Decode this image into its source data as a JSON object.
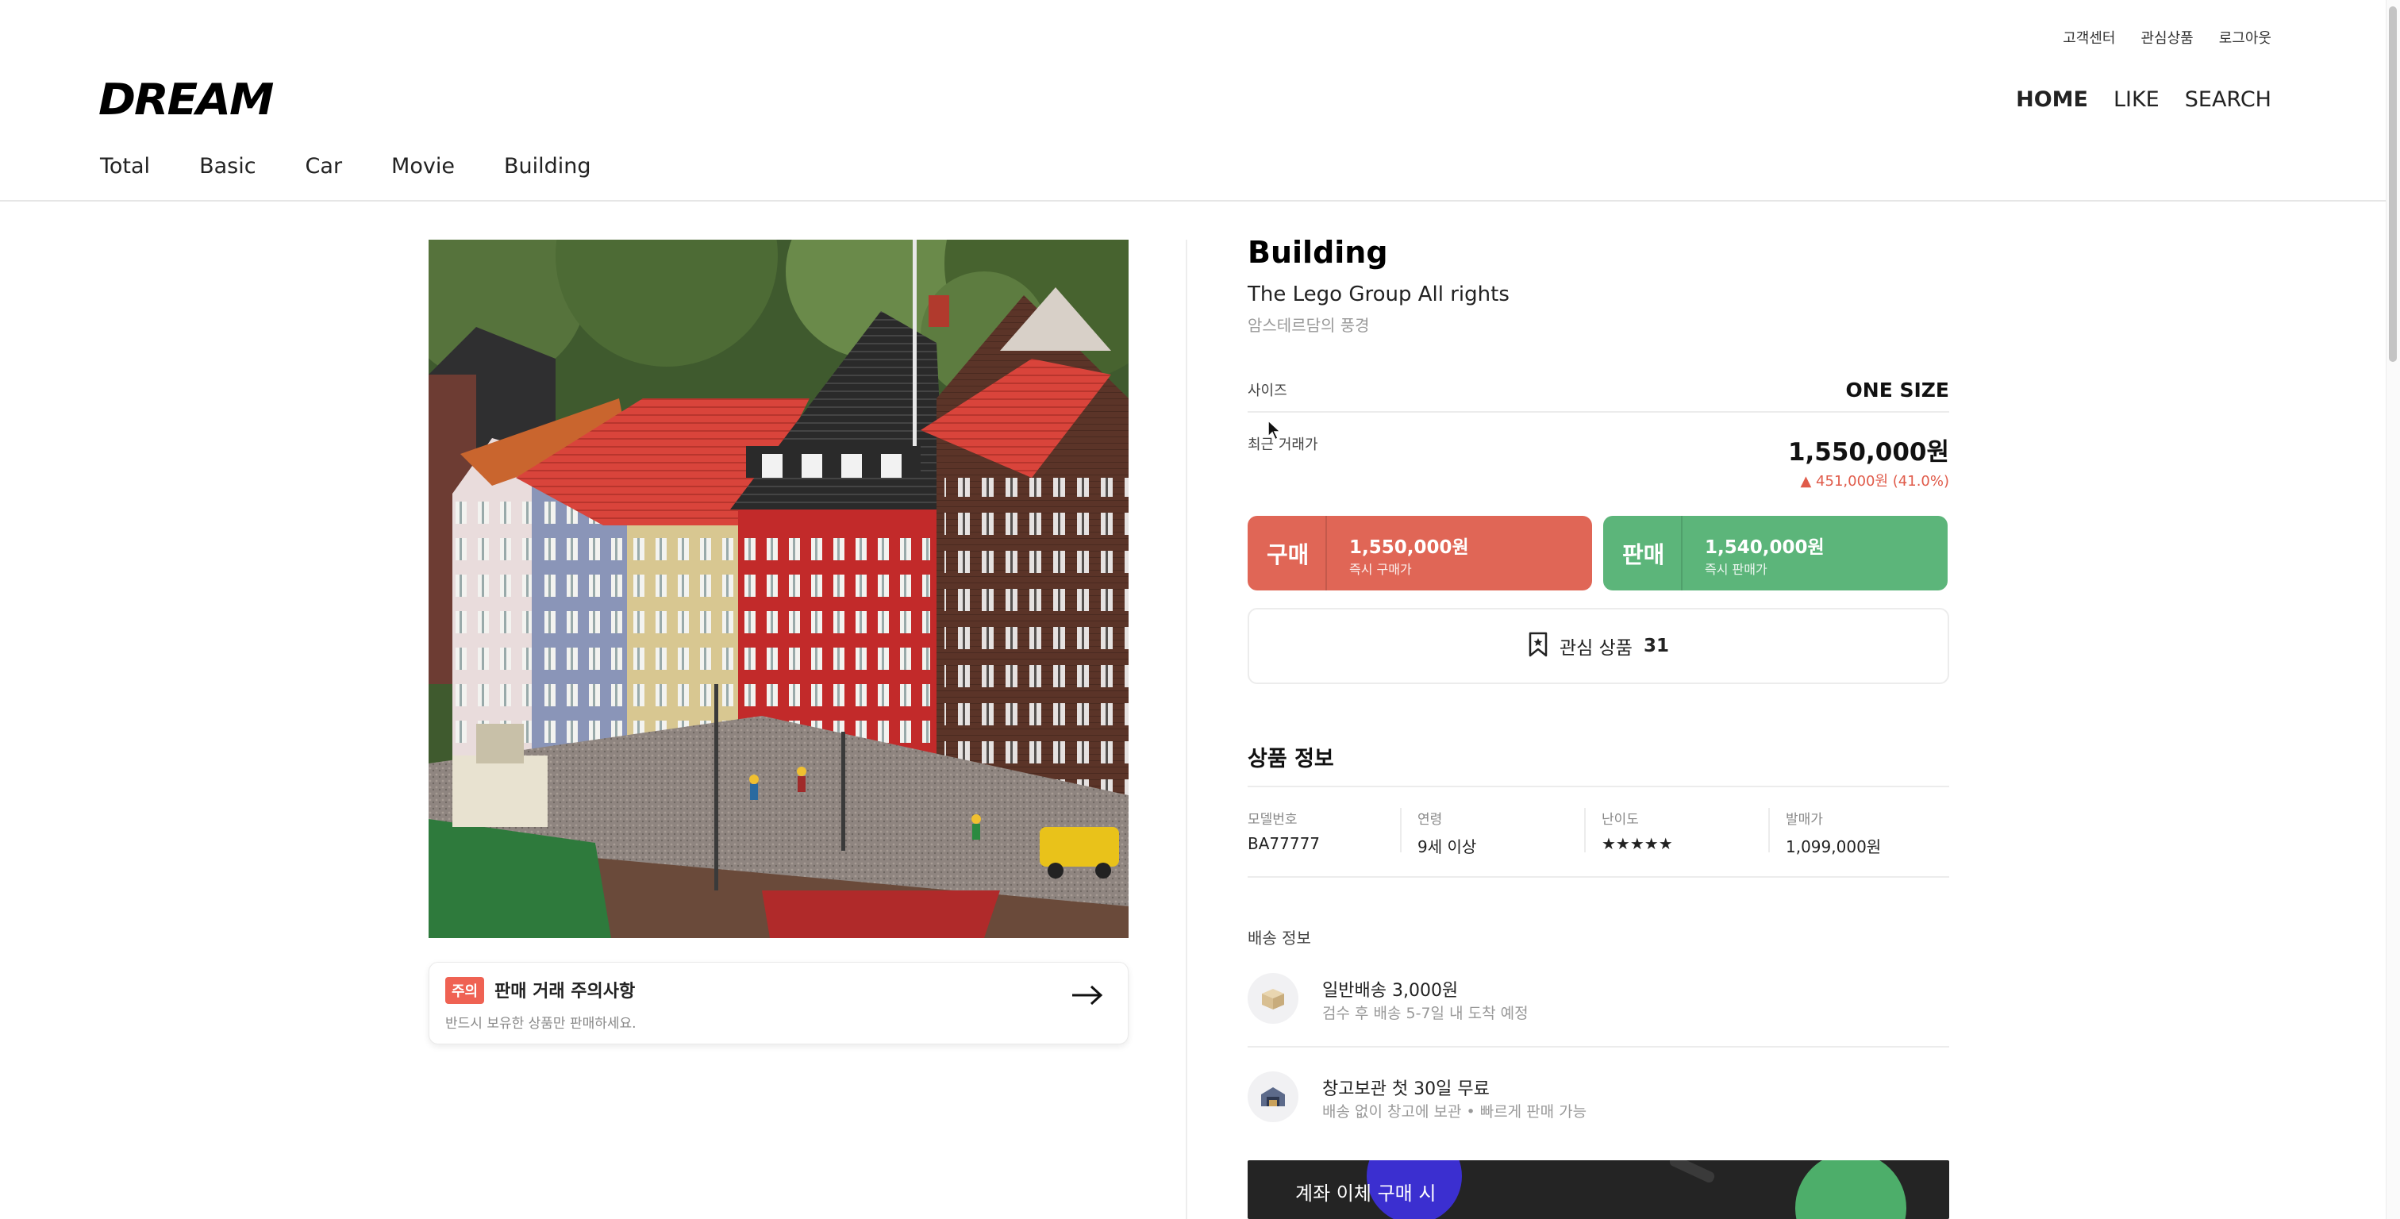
{
  "header": {
    "top_links": [
      "고객센터",
      "관심상품",
      "로그아웃"
    ],
    "logo": "DREAM",
    "main_nav": [
      "HOME",
      "LIKE",
      "SEARCH"
    ],
    "categories": [
      "Total",
      "Basic",
      "Car",
      "Movie",
      "Building"
    ]
  },
  "notice": {
    "badge": "주의",
    "title": "판매 거래 주의사항",
    "desc": "반드시 보유한 상품만 판매하세요."
  },
  "product": {
    "title": "Building",
    "brand": "The Lego Group All rights",
    "subtitle": "암스테르담의 풍경",
    "size_label": "사이즈",
    "size_value": "ONE SIZE",
    "price_label": "최근 거래가",
    "price_value": "1,550,000원",
    "price_change": "▲ 451,000원 (41.0%)"
  },
  "buy": {
    "label": "구매",
    "price": "1,550,000원",
    "caption": "즉시 구매가"
  },
  "sell": {
    "label": "판매",
    "price": "1,540,000원",
    "caption": "즉시 판매가"
  },
  "wish": {
    "label": "관심 상품",
    "count": "31"
  },
  "info": {
    "title": "상품 정보",
    "fields": [
      {
        "key": "모델번호",
        "value": "BA77777"
      },
      {
        "key": "연령",
        "value": "9세 이상"
      },
      {
        "key": "난이도",
        "value": "★★★★★"
      },
      {
        "key": "발매가",
        "value": "1,099,000원"
      }
    ]
  },
  "shipping": {
    "label": "배송 정보",
    "items": [
      {
        "title": "일반배송 3,000원",
        "desc": "검수 후 배송 5-7일 내 도착 예정"
      },
      {
        "title": "창고보관 첫 30일 무료",
        "desc": "배송 없이 창고에 보관 • 빠르게 판매 가능"
      }
    ]
  },
  "banner": {
    "text": "계좌 이체 구매 시"
  },
  "colors": {
    "buy": "#e06656",
    "sell": "#5cb57a",
    "price_up": "#e05b4a"
  }
}
